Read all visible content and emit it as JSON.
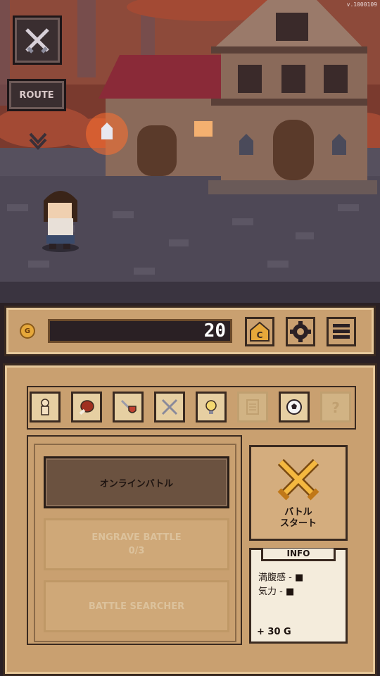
{
  "version": "v.1000109",
  "route_label": "ROUTE",
  "gold_icon_label": "G",
  "gold_amount": "20",
  "tabs": [
    {
      "name": "character-tab",
      "icon": "person-icon",
      "enabled": true
    },
    {
      "name": "food-tab",
      "icon": "meat-icon",
      "enabled": true
    },
    {
      "name": "equipment-tab",
      "icon": "sword-shield-icon",
      "enabled": true
    },
    {
      "name": "battle-tab",
      "icon": "crossed-swords-icon",
      "enabled": true
    },
    {
      "name": "skill-tab",
      "icon": "bulb-icon",
      "enabled": true
    },
    {
      "name": "document-tab",
      "icon": "scroll-icon",
      "enabled": false
    },
    {
      "name": "ball-tab",
      "icon": "ball-icon",
      "enabled": true
    },
    {
      "name": "unknown-tab",
      "icon": "question-icon",
      "enabled": false
    }
  ],
  "modes": {
    "online": "オンラインバトル",
    "engrave": "ENGRAVE BATTLE",
    "engrave_count": "0/3",
    "searcher": "BATTLE SEARCHER"
  },
  "start": {
    "line1": "バトル",
    "line2": "スタート"
  },
  "info": {
    "title": "INFO",
    "line1": "満腹感 - ■",
    "line2": "気力 - ■",
    "reward": "+ 30 G"
  },
  "colors": {
    "panel": "#c9a070",
    "border": "#3a2a20",
    "accent": "#e6a83a"
  }
}
